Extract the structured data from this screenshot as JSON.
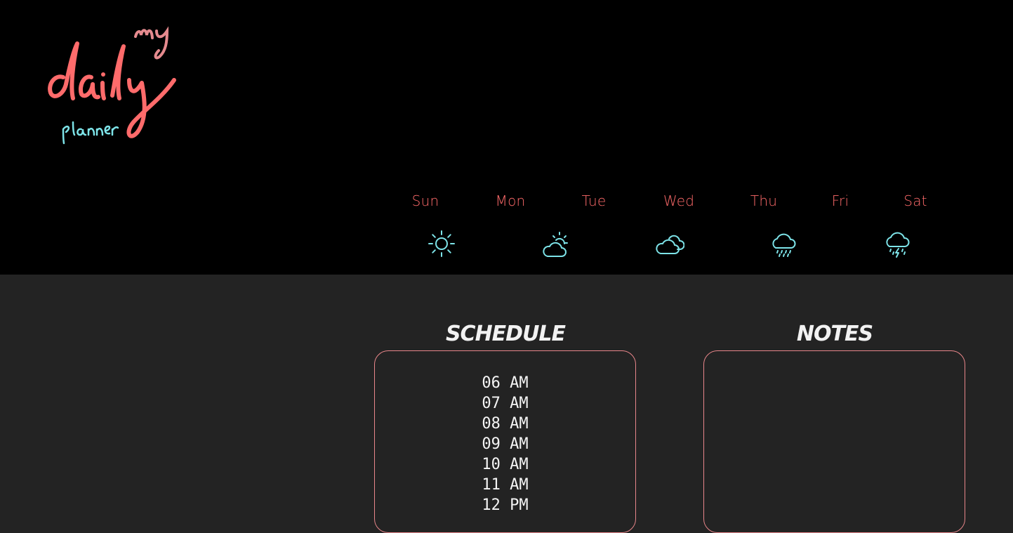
{
  "logo": {
    "line1": "my",
    "line2": "daily",
    "line3": "planner"
  },
  "days": [
    {
      "label": "Sun"
    },
    {
      "label": "Mon"
    },
    {
      "label": "Tue"
    },
    {
      "label": "Wed"
    },
    {
      "label": "Thu"
    },
    {
      "label": "Fri"
    },
    {
      "label": "Sat"
    }
  ],
  "weather_icons": [
    "sun-icon",
    "partly-cloudy-icon",
    "cloud-icon",
    "rain-icon",
    "thunderstorm-icon"
  ],
  "colors": {
    "accent": "#ff6b6b",
    "icon": "#7de3e8",
    "border": "#e8868a",
    "header_bg": "#000000",
    "page_bg": "#232323"
  },
  "schedule": {
    "title": "SCHEDULE",
    "hours": [
      "06 AM",
      "07 AM",
      "08 AM",
      "09 AM",
      "10 AM",
      "11 AM",
      "12 PM"
    ]
  },
  "notes": {
    "title": "NOTES"
  }
}
